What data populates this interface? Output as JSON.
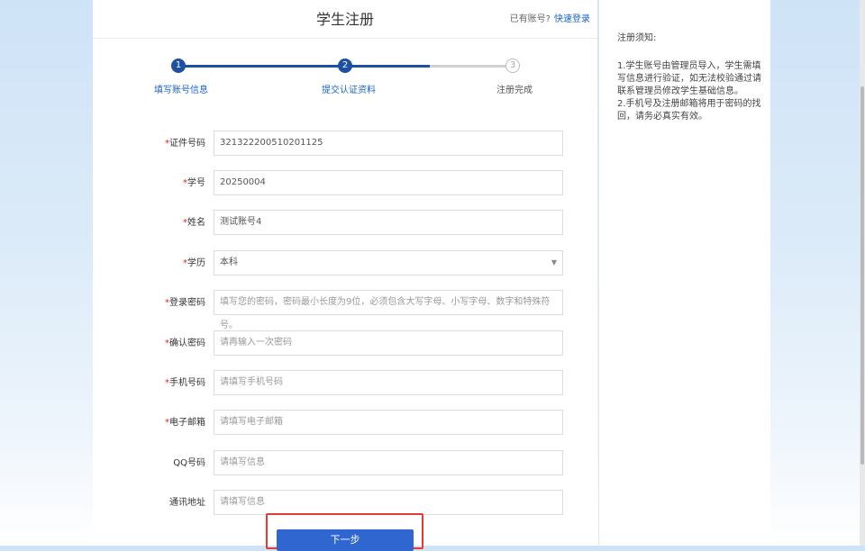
{
  "header": {
    "title": "学生注册",
    "login_prompt": "已有账号?",
    "login_link": "快速登录"
  },
  "steps": [
    {
      "number": "1",
      "label": "填写账号信息",
      "state": "done"
    },
    {
      "number": "2",
      "label": "提交认证资料",
      "state": "current"
    },
    {
      "number": "3",
      "label": "注册完成",
      "state": "todo"
    }
  ],
  "form": {
    "id_number": {
      "label": "证件号码",
      "required": "*",
      "value": "321322200510201125"
    },
    "student_no": {
      "label": "学号",
      "required": "*",
      "value": "20250004"
    },
    "name": {
      "label": "姓名",
      "required": "*",
      "value": "测试账号4"
    },
    "education": {
      "label": "学历",
      "required": "*",
      "value": "本科"
    },
    "password": {
      "label": "登录密码",
      "required": "*",
      "placeholder": "填写您的密码，密码最小长度为9位，必须包含大写字母、小写字母、数字和特殊符号。"
    },
    "confirm_password": {
      "label": "确认密码",
      "required": "*",
      "placeholder": "请再输入一次密码"
    },
    "phone": {
      "label": "手机号码",
      "required": "*",
      "placeholder": "请填写手机号码"
    },
    "email": {
      "label": "电子邮箱",
      "required": "*",
      "placeholder": "请填写电子邮箱"
    },
    "qq": {
      "label": "QQ号码",
      "placeholder": "请填写信息"
    },
    "address": {
      "label": "通讯地址",
      "placeholder": "请填写信息"
    }
  },
  "next_button": "下一步",
  "notice": {
    "title": "注册须知:",
    "item1": "1.学生账号由管理员导入，学生需填写信息进行验证，如无法校验通过请联系管理员修改学生基础信息。",
    "item2": "2.手机号及注册邮箱将用于密码的找回，请务必真实有效。"
  },
  "colors": {
    "primary": "#2f66d0",
    "step_done": "#1d4fa3",
    "required": "#e02020",
    "highlight": "#e53935"
  }
}
